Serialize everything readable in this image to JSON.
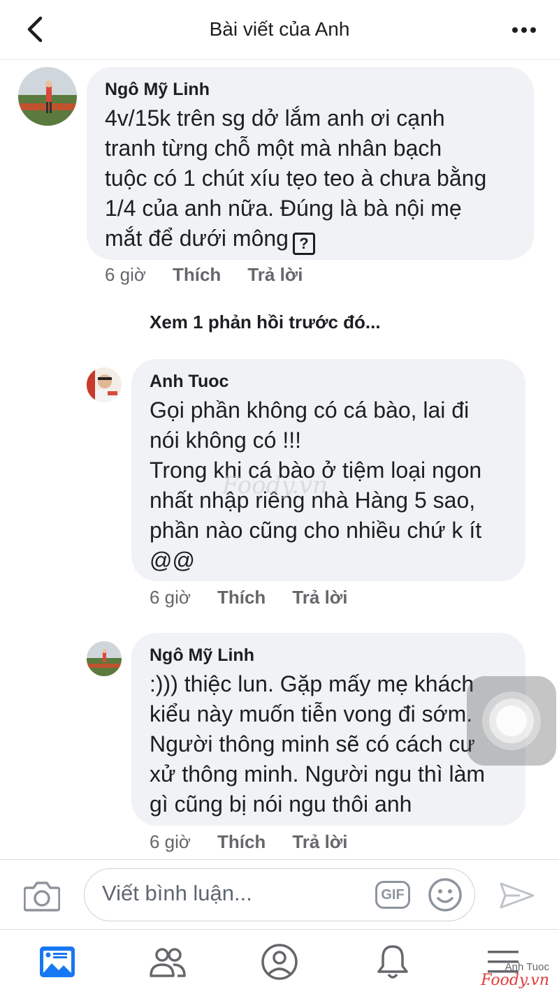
{
  "header": {
    "title": "Bài viết của Anh"
  },
  "comments": [
    {
      "author": "Ngô Mỹ Linh",
      "text": "4v/15k trên sg dở lắm anh ơi cạnh\ntranh từng chỗ một mà nhân bạch\ntuộc có 1 chút xíu tẹo teo à chưa bằng\n1/4 của anh nữa. Đúng là bà nội mẹ\nmắt để dưới mông",
      "time": "6 giờ",
      "like": "Thích",
      "reply": "Trả lời"
    }
  ],
  "view_previous": "Xem 1 phản hồi trước đó...",
  "replies": [
    {
      "author": "Anh Tuoc",
      "text": "Gọi phần không có cá bào, lai đi\nnói không có !!!\nTrong khi cá bào ở tiệm loại ngon\nnhất nhập riêng nhà Hàng 5 sao,\nphần nào cũng cho nhiều chứ k ít\n@@",
      "time": "6 giờ",
      "like": "Thích",
      "reply": "Trả lời"
    },
    {
      "author": "Ngô Mỹ Linh",
      "text": ":))) thiệc lun. Gặp mấy mẹ khách\nkiểu này muốn tiễn vong đi sớm.\nNgười thông minh sẽ có cách cư\nxử thông minh. Người ngu thì làm\ngì cũng bị nói ngu thôi anh",
      "time": "6 giờ",
      "like": "Thích",
      "reply": "Trả lời"
    }
  ],
  "watermark": "Foody.vn",
  "composer": {
    "placeholder": "Viết bình luận...",
    "gif_label": "GIF"
  },
  "corner_mark": {
    "name": "Anh Tuoc",
    "brand": "Foody.vn"
  },
  "colors": {
    "bubble": "#f0f2f5",
    "active_tab": "#1877f2",
    "meta_text": "#65676b"
  },
  "icons": [
    "back-arrow-icon",
    "more-dots-icon",
    "camera-icon",
    "gif-icon",
    "emoji-icon",
    "send-icon",
    "news-feed-icon",
    "friends-icon",
    "profile-icon",
    "bell-icon",
    "menu-icon"
  ]
}
